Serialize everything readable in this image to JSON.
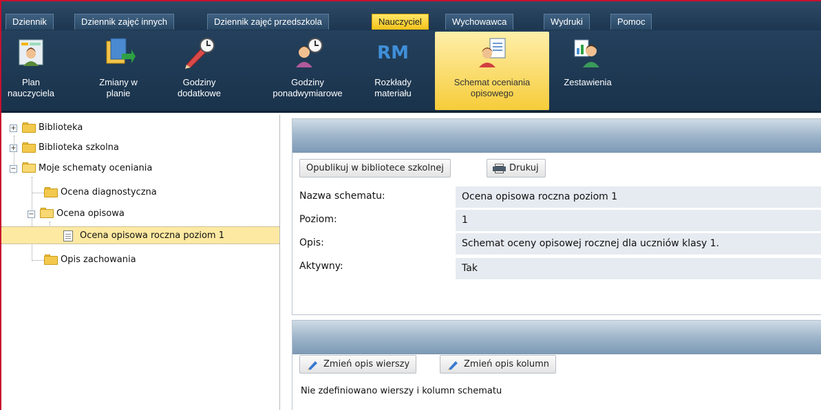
{
  "tabs": [
    {
      "label": "Dziennik",
      "active": false
    },
    {
      "label": "Dziennik zajęć innych",
      "active": false
    },
    {
      "label": "Dziennik zajęć przedszkola",
      "active": false
    },
    {
      "label": "Nauczyciel",
      "active": true
    },
    {
      "label": "Wychowawca",
      "active": false
    },
    {
      "label": "Wydruki",
      "active": false
    },
    {
      "label": "Pomoc",
      "active": false
    }
  ],
  "ribbon": [
    {
      "line1": "Plan",
      "line2": "nauczyciela",
      "icon": "teacher-plan-icon"
    },
    {
      "line1": "Zmiany w",
      "line2": "planie",
      "icon": "plan-changes-icon"
    },
    {
      "line1": "Godziny",
      "line2": "dodatkowe",
      "icon": "extra-hours-icon"
    },
    {
      "line1": "Godziny",
      "line2": "ponadwymiarowe",
      "icon": "overtime-hours-icon"
    },
    {
      "line1": "Rozkłady",
      "line2": "materiału",
      "icon": "rm-icon",
      "icon_text": "RM"
    },
    {
      "line1": "Schemat oceniania",
      "line2": "opisowego",
      "icon": "descriptive-grading-icon",
      "active": true
    },
    {
      "line1": "Zestawienia",
      "line2": "",
      "icon": "reports-icon"
    }
  ],
  "tree": {
    "biblioteka": "Biblioteka",
    "biblioteka_szkolna": "Biblioteka szkolna",
    "moje_schematy": "Moje schematy oceniania",
    "ocena_diagnostyczna": "Ocena diagnostyczna",
    "ocena_opisowa": "Ocena opisowa",
    "selected_item": "Ocena opisowa roczna poziom 1",
    "opis_zachowania": "Opis zachowania"
  },
  "details": {
    "publish_button": "Opublikuj w bibliotece szkolnej",
    "print_button": "Drukuj",
    "fields": [
      {
        "label": "Nazwa schematu:",
        "value": "Ocena opisowa roczna poziom 1"
      },
      {
        "label": "Poziom:",
        "value": "1"
      },
      {
        "label": "Opis:",
        "value": "Schemat oceny opisowej rocznej dla uczniów klasy 1."
      },
      {
        "label": "Aktywny:",
        "value": "Tak"
      }
    ]
  },
  "schema": {
    "change_rows_button": "Zmień opis wierszy",
    "change_columns_button": "Zmień opis kolumn",
    "empty_message": "Nie zdefiniowano wierszy i kolumn schematu"
  },
  "colors": {
    "accent_active": "#f4c21a",
    "ribbon_bg": "#1a334c",
    "selected_row": "#fde9a2",
    "frame": "#c8102e"
  }
}
